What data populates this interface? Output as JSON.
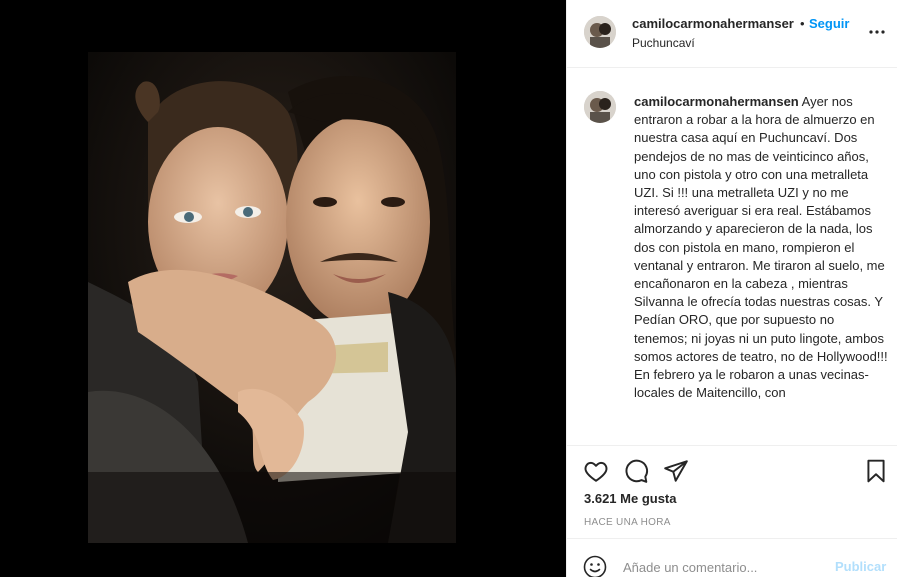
{
  "post": {
    "username": "camilocarmonahermanser",
    "follow_label": "Seguir",
    "separator": "•",
    "location": "Puchuncaví"
  },
  "caption": {
    "username": "camilocarmonahermansen",
    "text": "Ayer nos entraron a robar a la hora de almuerzo en nuestra casa aquí en Puchuncaví. Dos pendejos de no mas de veinticinco años, uno con pistola y otro con una metralleta UZI. Si !!! una metralleta UZI y no me interesó averiguar si era real. Estábamos almorzando y aparecieron de la nada, los dos con pistola en mano, rompieron el ventanal y entraron. Me tiraron al suelo, me encañonaron en la cabeza , mientras Silvanna le ofrecía todas nuestras cosas. Y Pedían ORO, que por supuesto no tenemos; ni joyas ni un puto lingote, ambos somos actores de teatro, no de Hollywood!!! En febrero ya le robaron a unas vecinas-locales de Maitencillo, con"
  },
  "stats": {
    "likes": "3.621 Me gusta",
    "time": "HACE UNA HORA"
  },
  "comment_box": {
    "placeholder": "Añade un comentario...",
    "publish_label": "Publicar"
  },
  "icons": {
    "more": "more-options-icon",
    "like": "heart-icon",
    "comment": "comment-bubble-icon",
    "share": "paper-plane-icon",
    "save": "bookmark-icon",
    "emoji": "smiley-face-icon"
  },
  "colors": {
    "link_blue": "#0095f6",
    "publish_disabled": "#b2dffc",
    "muted_text": "#8e8e8e",
    "border": "#efefef"
  }
}
